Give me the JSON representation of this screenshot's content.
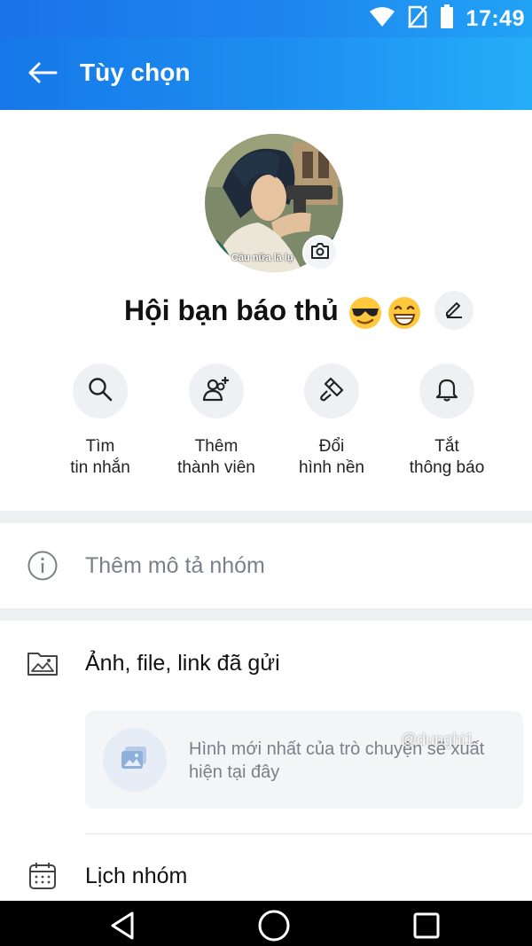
{
  "status_bar": {
    "time": "17:49",
    "icons": [
      "wifi-icon",
      "no-sim-icon",
      "battery-icon"
    ]
  },
  "app_bar": {
    "title": "Tùy chọn",
    "back_icon": "arrow-left-icon"
  },
  "profile": {
    "avatar_caption": "Câu nữa là lụ",
    "group_name": "Hội bạn báo thủ",
    "emojis": [
      "sunglasses-emoji",
      "grinning-emoji"
    ]
  },
  "actions": [
    {
      "label": "Tìm\ntin nhắn",
      "icon": "search-icon"
    },
    {
      "label": "Thêm\nthành viên",
      "icon": "add-user-icon"
    },
    {
      "label": "Đổi\nhình nền",
      "icon": "paint-brush-icon"
    },
    {
      "label": "Tắt\nthông báo",
      "icon": "bell-icon"
    }
  ],
  "description_row": {
    "label": "Thêm mô tả nhóm",
    "icon": "info-icon"
  },
  "media_row": {
    "label": "Ảnh, file, link đã gửi",
    "icon": "photo-folder-icon",
    "empty_text": "Hình mới nhất của trò chuyện sẽ xuất hiện tại đây",
    "watermark": "@dunghi1"
  },
  "calendar_row": {
    "label": "Lịch nhóm",
    "icon": "calendar-icon"
  },
  "colors": {
    "accent_start": "#1678e8",
    "accent_end": "#24aef8",
    "muted_text": "#7b8088"
  }
}
